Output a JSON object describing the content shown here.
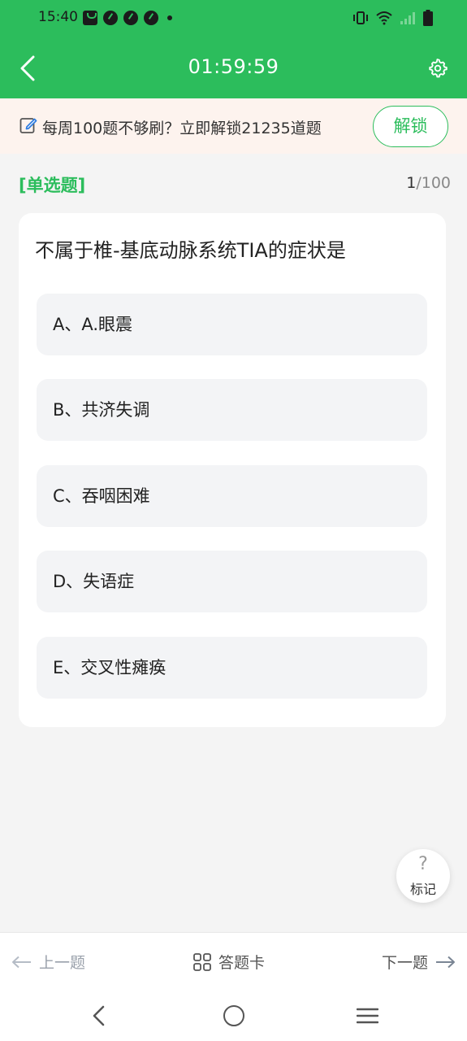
{
  "status_bar": {
    "time": "15:40"
  },
  "header": {
    "timer": "01:59:59",
    "back_icon": "chevron-left-icon",
    "settings_icon": "gear-icon"
  },
  "promo": {
    "text": "每周100题不够刷？立即解锁21235道题",
    "button_label": "解锁",
    "icon": "edit-icon"
  },
  "question": {
    "type": "[单选题]",
    "current": "1",
    "total": "/100",
    "text": "不属于椎-基底动脉系统TIA的症状是",
    "options": [
      {
        "label": "A、A.眼震"
      },
      {
        "label": "B、共济失调"
      },
      {
        "label": "C、吞咽困难"
      },
      {
        "label": "D、失语症"
      },
      {
        "label": "E、交叉性瘫痪"
      }
    ]
  },
  "mark": {
    "icon_text": "?",
    "label": "标记"
  },
  "bottom_nav": {
    "prev": "上一题",
    "card": "答题卡",
    "next": "下一题"
  },
  "colors": {
    "brand_green": "#2cbd5c",
    "promo_bg": "#fdf3ee",
    "option_bg": "#f3f4f6"
  }
}
